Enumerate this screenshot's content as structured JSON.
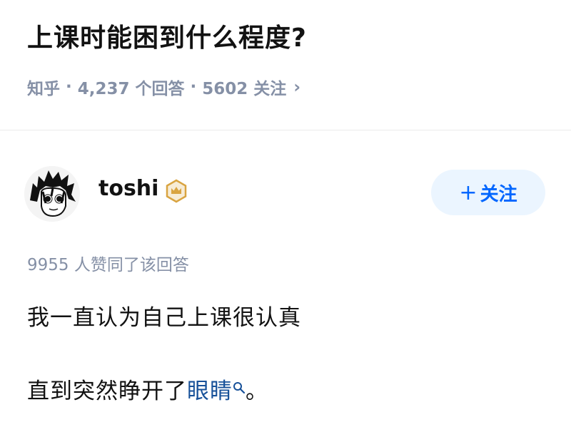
{
  "question": {
    "title": "上课时能困到什么程度?",
    "source": "知乎",
    "answers": "4,237 个回答",
    "followers": "5602 关注",
    "chevron": "›"
  },
  "author": {
    "name": "toshi",
    "badge_icon": "crown-badge-icon",
    "follow_plus": "+",
    "follow_label": "关注"
  },
  "answer": {
    "votes": "9955 人赞同了该回答",
    "paragraph1": "我一直认为自己上课很认真",
    "paragraph2_before": "直到突然睁开了",
    "paragraph2_link": "眼睛",
    "paragraph2_after": "。"
  },
  "colors": {
    "accent": "#0066ff",
    "link": "#175199",
    "meta": "#8590a6",
    "follow_bg": "#ebf5ff",
    "badge": "#d9a441"
  }
}
